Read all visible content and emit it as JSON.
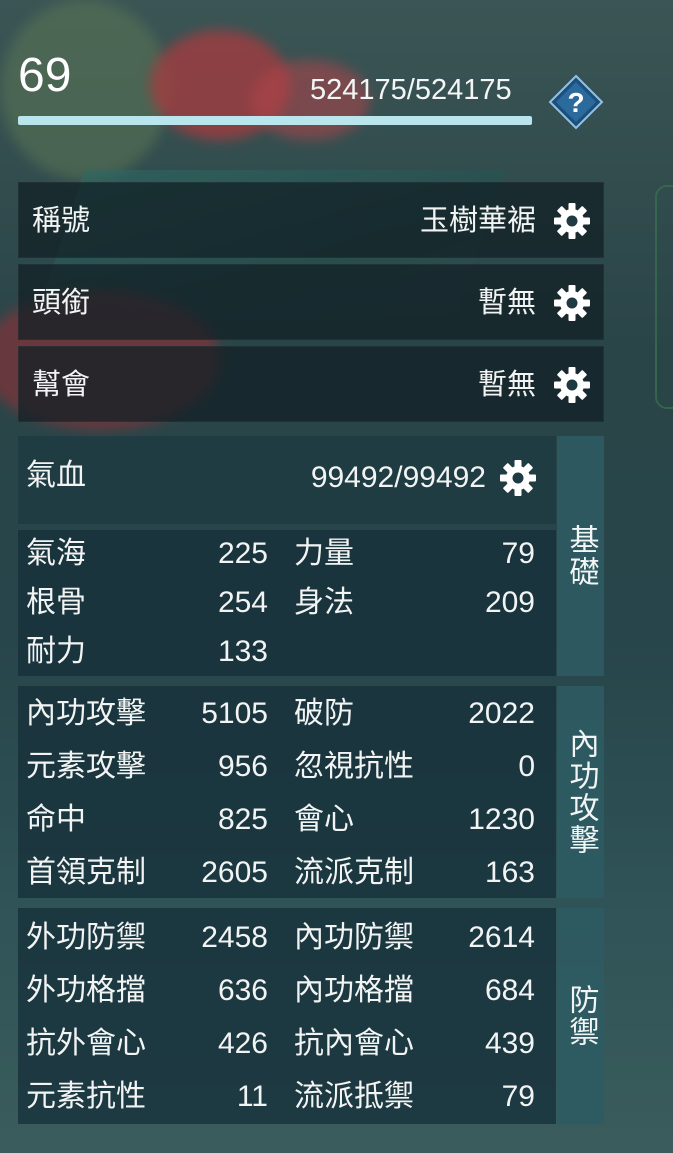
{
  "header": {
    "level": "69",
    "hp_text": "524175/524175",
    "hp_fraction": 1.0
  },
  "identity": [
    {
      "label": "稱號",
      "value": "玉樹華裾"
    },
    {
      "label": "頭銜",
      "value": "暫無"
    },
    {
      "label": "幫會",
      "value": "暫無"
    }
  ],
  "basic": {
    "tab": "基礎",
    "qixue_label": "氣血",
    "qixue_value": "99492/99492",
    "stats": [
      {
        "label": "氣海",
        "value": "225"
      },
      {
        "label": "力量",
        "value": "79"
      },
      {
        "label": "根骨",
        "value": "254"
      },
      {
        "label": "身法",
        "value": "209"
      },
      {
        "label": "耐力",
        "value": "133"
      }
    ]
  },
  "attack": {
    "tab": "內功攻擊",
    "stats": [
      {
        "label": "內功攻擊",
        "value": "5105"
      },
      {
        "label": "破防",
        "value": "2022"
      },
      {
        "label": "元素攻擊",
        "value": "956"
      },
      {
        "label": "忽視抗性",
        "value": "0"
      },
      {
        "label": "命中",
        "value": "825"
      },
      {
        "label": "會心",
        "value": "1230"
      },
      {
        "label": "首領克制",
        "value": "2605"
      },
      {
        "label": "流派克制",
        "value": "163"
      }
    ]
  },
  "defense": {
    "tab": "防禦",
    "stats": [
      {
        "label": "外功防禦",
        "value": "2458"
      },
      {
        "label": "內功防禦",
        "value": "2614"
      },
      {
        "label": "外功格擋",
        "value": "636"
      },
      {
        "label": "內功格擋",
        "value": "684"
      },
      {
        "label": "抗外會心",
        "value": "426"
      },
      {
        "label": "抗內會心",
        "value": "439"
      },
      {
        "label": "元素抗性",
        "value": "11"
      },
      {
        "label": "流派抵禦",
        "value": "79"
      }
    ]
  },
  "icons": {
    "help": "question-diamond-icon",
    "settings": "gear-icon"
  },
  "colors": {
    "hp_fill": "#b9e6ec",
    "tab_bg": "#2e5a62"
  }
}
